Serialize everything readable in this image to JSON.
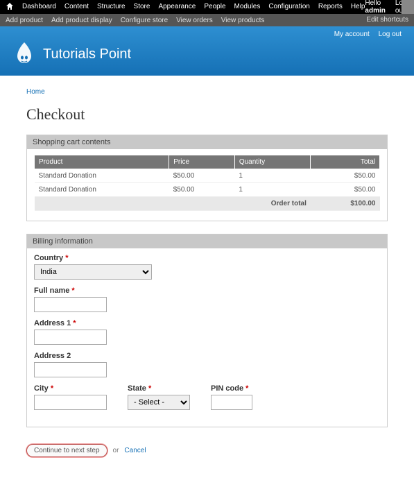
{
  "adminMenu": {
    "items": [
      "Dashboard",
      "Content",
      "Structure",
      "Store",
      "Appearance",
      "People",
      "Modules",
      "Configuration",
      "Reports",
      "Help"
    ],
    "hello": "Hello",
    "user": "admin",
    "logout": "Log out"
  },
  "shortcuts": {
    "items": [
      "Add product",
      "Add product display",
      "Configure store",
      "View orders",
      "View products"
    ],
    "edit": "Edit shortcuts"
  },
  "header": {
    "myAccount": "My account",
    "logout": "Log out",
    "siteName": "Tutorials Point"
  },
  "breadcrumb": {
    "home": "Home"
  },
  "page": {
    "title": "Checkout"
  },
  "cart": {
    "header": "Shopping cart contents",
    "columns": {
      "product": "Product",
      "price": "Price",
      "qty": "Quantity",
      "total": "Total"
    },
    "rows": [
      {
        "product": "Standard Donation",
        "price": "$50.00",
        "qty": "1",
        "total": "$50.00"
      },
      {
        "product": "Standard Donation",
        "price": "$50.00",
        "qty": "1",
        "total": "$50.00"
      }
    ],
    "orderTotalLabel": "Order total",
    "orderTotal": "$100.00"
  },
  "billing": {
    "header": "Billing information",
    "country": {
      "label": "Country",
      "value": "India"
    },
    "fullname": {
      "label": "Full name"
    },
    "address1": {
      "label": "Address 1"
    },
    "address2": {
      "label": "Address 2"
    },
    "city": {
      "label": "City"
    },
    "state": {
      "label": "State",
      "value": "- Select -"
    },
    "pin": {
      "label": "PIN code"
    }
  },
  "actions": {
    "continue": "Continue to next step",
    "or": "or",
    "cancel": "Cancel"
  }
}
